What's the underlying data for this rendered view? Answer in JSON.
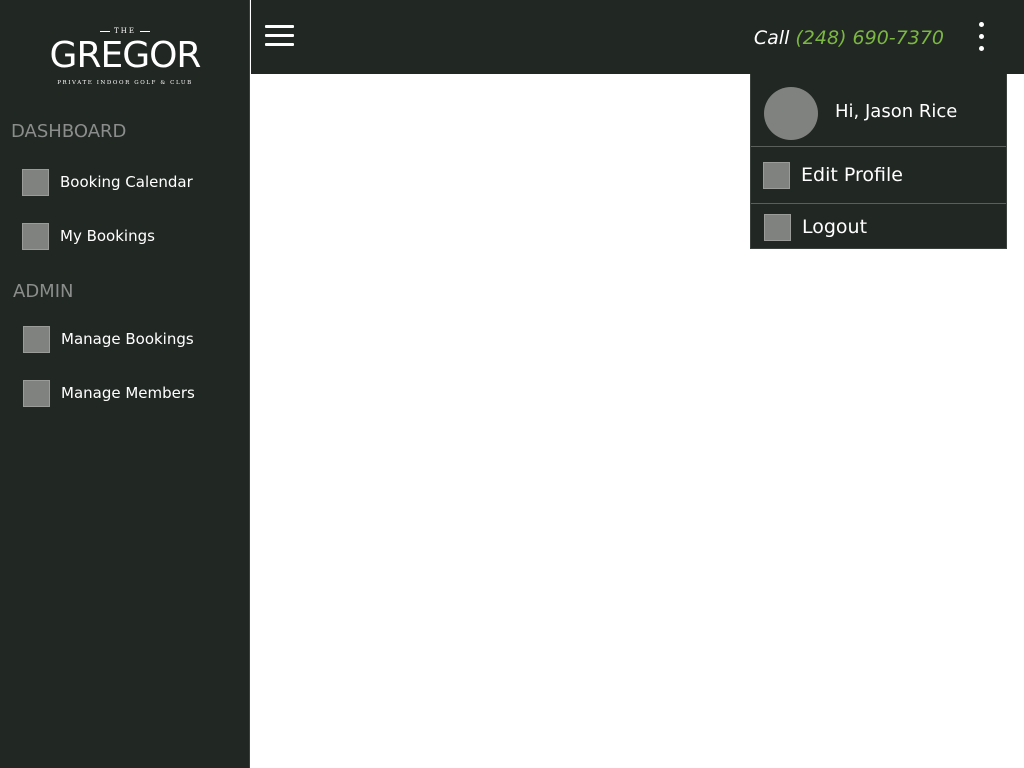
{
  "brand": {
    "the": "THE",
    "name": "GREGOR",
    "tagline": "PRIVATE INDOOR GOLF & CLUB"
  },
  "sidebar": {
    "sections": [
      {
        "title": "DASHBOARD",
        "items": [
          {
            "label": "Booking Calendar",
            "icon": "placeholder-icon"
          },
          {
            "label": "My Bookings",
            "icon": "placeholder-icon"
          }
        ]
      },
      {
        "title": "ADMIN",
        "items": [
          {
            "label": "Manage Bookings",
            "icon": "placeholder-icon"
          },
          {
            "label": "Manage Members",
            "icon": "placeholder-icon"
          }
        ]
      }
    ]
  },
  "header": {
    "call_prefix": "Call",
    "phone": "(248) 690-7370"
  },
  "user_menu": {
    "greeting": "Hi, Jason Rice",
    "items": [
      {
        "label": "Edit Profile"
      },
      {
        "label": "Logout"
      }
    ]
  },
  "colors": {
    "sidebar_bg": "#212723",
    "accent_green": "#7cb742",
    "section_title": "#8a8d8b",
    "placeholder": "#808280"
  }
}
